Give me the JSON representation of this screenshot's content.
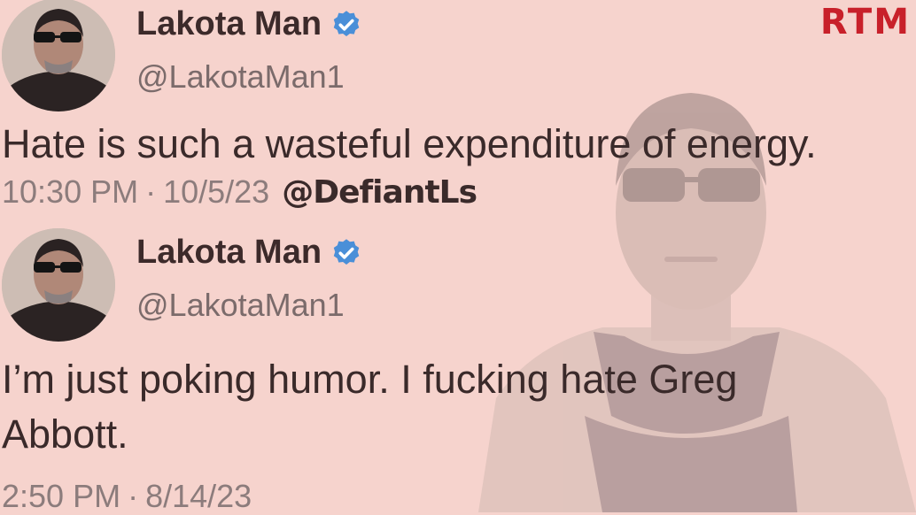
{
  "brand": {
    "logo_text": "RTM",
    "logo_color": "#c8202a"
  },
  "colors": {
    "background": "#f6d3cd",
    "verified_blue": "#4a8fd8"
  },
  "tweets": [
    {
      "display_name": "Lakota Man",
      "verified_icon": "verified-badge-icon",
      "handle": "@LakotaMan1",
      "text": "Hate is such a wasteful expenditure of energy.",
      "time": "10:30 PM",
      "separator": "·",
      "date": "10/5/23",
      "watermark": "@DefiantLs"
    },
    {
      "display_name": "Lakota Man",
      "verified_icon": "verified-badge-icon",
      "handle": "@LakotaMan1",
      "text": "I’m just poking humor. I fucking hate Greg Abbott.",
      "time": "2:50 PM",
      "separator": "·",
      "date": "8/14/23"
    }
  ]
}
